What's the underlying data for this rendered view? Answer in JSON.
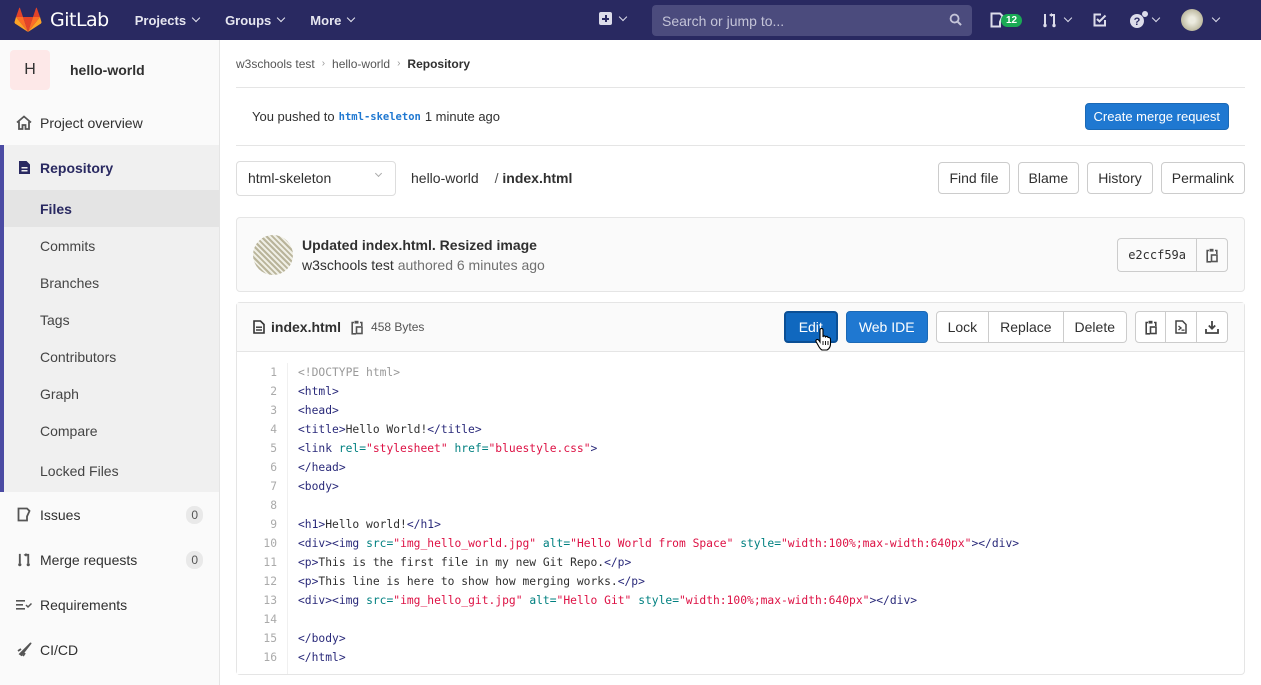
{
  "topbar": {
    "brand": "GitLab",
    "nav": [
      {
        "label": "Projects"
      },
      {
        "label": "Groups"
      },
      {
        "label": "More"
      }
    ],
    "search_placeholder": "Search or jump to...",
    "issues_count": "12",
    "icons": [
      "plus-icon",
      "issues-icon",
      "merge-request-icon",
      "todo-icon",
      "help-icon",
      "user-avatar"
    ]
  },
  "sidebar": {
    "project_initial": "H",
    "project_name": "hello-world",
    "overview": "Project overview",
    "repository": {
      "label": "Repository",
      "items": [
        {
          "label": "Files",
          "active": true
        },
        {
          "label": "Commits"
        },
        {
          "label": "Branches"
        },
        {
          "label": "Tags"
        },
        {
          "label": "Contributors"
        },
        {
          "label": "Graph"
        },
        {
          "label": "Compare"
        },
        {
          "label": "Locked Files"
        }
      ]
    },
    "issues": {
      "label": "Issues",
      "count": "0"
    },
    "merge_requests": {
      "label": "Merge requests",
      "count": "0"
    },
    "requirements": "Requirements",
    "cicd": "CI/CD"
  },
  "breadcrumb": [
    "w3schools test",
    "hello-world",
    "Repository"
  ],
  "push_notice": {
    "prefix": "You pushed to",
    "branch": "html-skeleton",
    "suffix": "1 minute ago",
    "button": "Create merge request"
  },
  "tree": {
    "branch": "html-skeleton",
    "path_root": "hello-world",
    "path_sep": "/",
    "file": "index.html",
    "buttons": [
      "Find file",
      "Blame",
      "History",
      "Permalink"
    ]
  },
  "commit": {
    "title": "Updated index.html. Resized image",
    "author": "w3schools test",
    "meta": "authored 6 minutes ago",
    "sha": "e2ccf59a"
  },
  "file": {
    "name": "index.html",
    "size": "458 Bytes",
    "edit": "Edit",
    "web_ide": "Web IDE",
    "lock": "Lock",
    "replace": "Replace",
    "delete": "Delete"
  },
  "code_lines": [
    "<!DOCTYPE html>",
    "<html>",
    "<head>",
    "<title>Hello World!</title>",
    "<link rel=\"stylesheet\" href=\"bluestyle.css\">",
    "</head>",
    "<body>",
    "",
    "<h1>Hello world!</h1>",
    "<div><img src=\"img_hello_world.jpg\" alt=\"Hello World from Space\" style=\"width:100%;max-width:640px\"></div>",
    "<p>This is the first file in my new Git Repo.</p>",
    "<p>This line is here to show how merging works.</p>",
    "<div><img src=\"img_hello_git.jpg\" alt=\"Hello Git\" style=\"width:100%;max-width:640px\"></div>",
    "",
    "</body>",
    "</html>"
  ],
  "colors": {
    "nav_bg": "#292961",
    "accent": "#1f78d1",
    "badge": "#1aaa55",
    "sidebar_accent": "#4b4ba3"
  }
}
